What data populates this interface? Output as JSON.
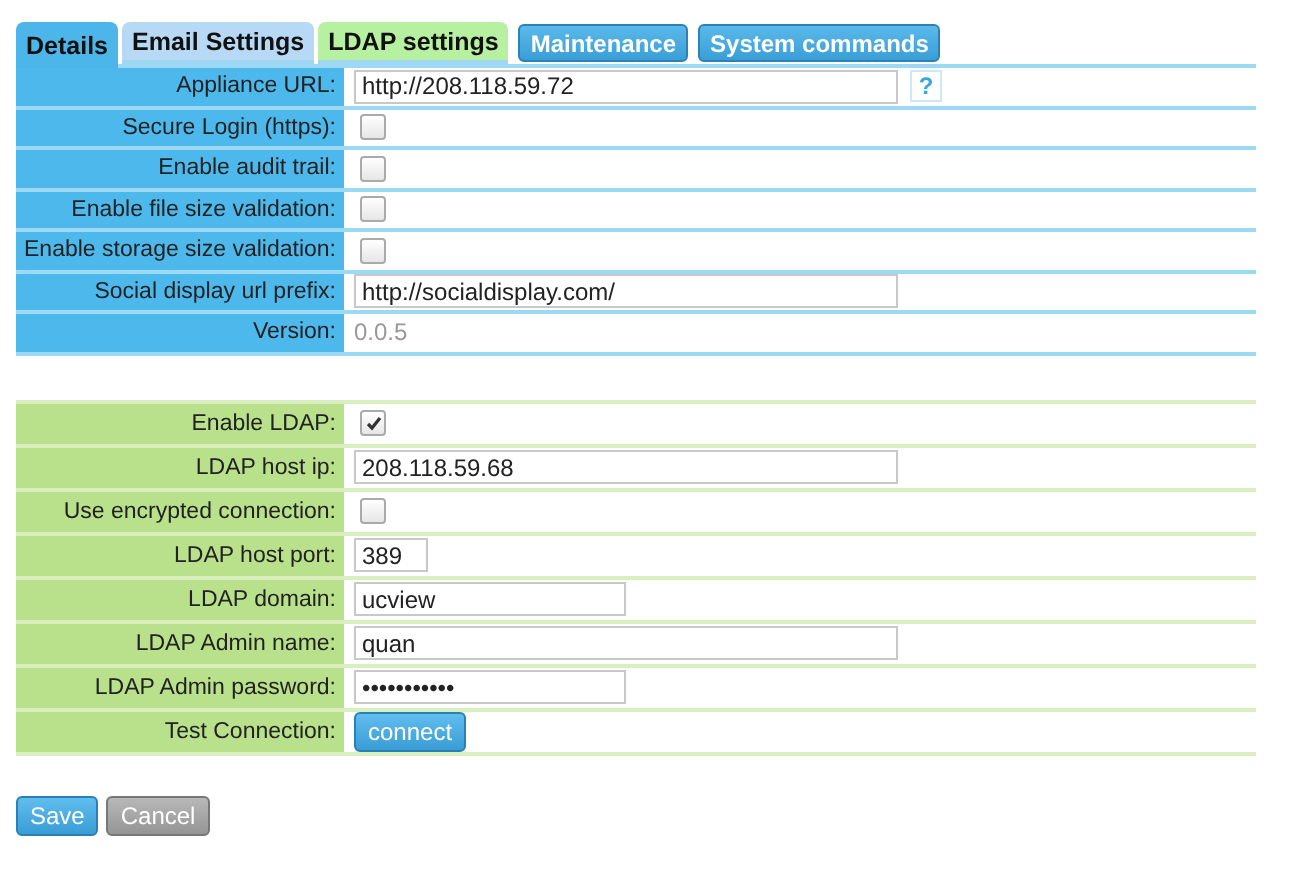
{
  "tabs": [
    {
      "label": "Details",
      "kind": "tab",
      "selected": true,
      "color": "#4cb6ea"
    },
    {
      "label": "Email Settings",
      "kind": "tab",
      "selected": false,
      "color": "#b7d9f5"
    },
    {
      "label": "LDAP settings",
      "kind": "tab",
      "selected": false,
      "color": "#b8f0a2"
    },
    {
      "label": "Maintenance",
      "kind": "button"
    },
    {
      "label": "System commands",
      "kind": "button"
    }
  ],
  "sections": [
    {
      "color": "#4db8ec",
      "rows": [
        {
          "label": "Appliance URL:",
          "kind": "longtext",
          "value": "http://208.118.59.72",
          "help": "?"
        },
        {
          "label": "Secure Login (https):",
          "kind": "checkbox",
          "checked": false
        },
        {
          "label": "Enable audit trail:",
          "kind": "checkbox",
          "checked": false
        },
        {
          "label": "Enable file size validation:",
          "kind": "checkbox",
          "checked": false
        },
        {
          "label": "Enable storage size validation:",
          "kind": "checkbox",
          "checked": false
        },
        {
          "label": "Social display url prefix:",
          "kind": "longtext",
          "value": "http://socialdisplay.com/"
        },
        {
          "label": "Version:",
          "kind": "static",
          "value": "0.0.5"
        }
      ]
    },
    {
      "color": "#b9e18c",
      "rows": [
        {
          "label": "Enable LDAP:",
          "kind": "checkbox",
          "checked": true
        },
        {
          "label": "LDAP host ip:",
          "kind": "longtext",
          "value": "208.118.59.68"
        },
        {
          "label": "Use encrypted connection:",
          "kind": "checkbox",
          "checked": false
        },
        {
          "label": "LDAP host port:",
          "kind": "tinytext",
          "value": "389"
        },
        {
          "label": "LDAP domain:",
          "kind": "text",
          "value": "ucview"
        },
        {
          "label": "LDAP Admin name:",
          "kind": "longtext",
          "value": "quan"
        },
        {
          "label": "LDAP Admin password:",
          "kind": "text",
          "value": "•••••••••••"
        },
        {
          "label": "Test Connection:",
          "kind": "button",
          "value": "connect"
        }
      ]
    }
  ],
  "actions": [
    {
      "label": "Save",
      "disabled": false
    },
    {
      "label": "Cancel",
      "disabled": true
    }
  ]
}
